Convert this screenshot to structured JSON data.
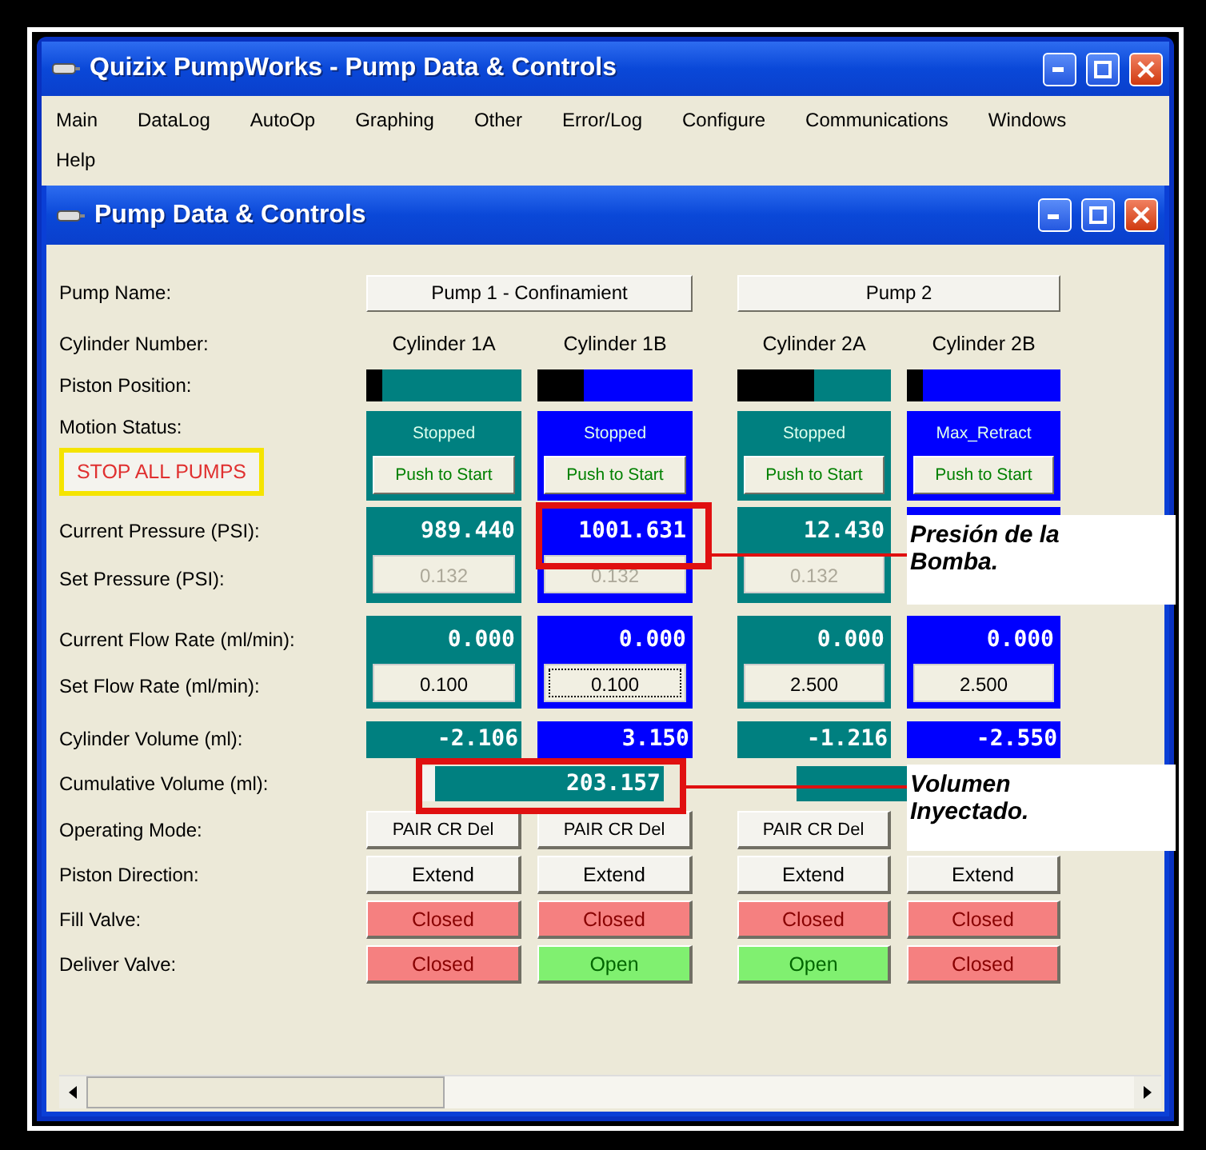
{
  "window": {
    "title": "Quizix PumpWorks - Pump Data & Controls"
  },
  "menu": [
    "Main",
    "DataLog",
    "AutoOp",
    "Graphing",
    "Other",
    "Error/Log",
    "Configure",
    "Communications",
    "Windows",
    "Help"
  ],
  "child_window": {
    "title": "Pump Data & Controls"
  },
  "row_labels": [
    "Pump Name:",
    "Cylinder Number:",
    "Piston Position:",
    "Motion Status:",
    "Current Pressure (PSI):",
    "Set Pressure (PSI):",
    "Current Flow Rate (ml/min):",
    "Set Flow Rate (ml/min):",
    "Cylinder Volume (ml):",
    "Cumulative Volume (ml):",
    "Operating Mode:",
    "Piston Direction:",
    "Fill Valve:",
    "Deliver Valve:"
  ],
  "stop_button": "STOP ALL PUMPS",
  "pumps": [
    {
      "name": "Pump 1 - Confinamient",
      "cumulative": "203.157",
      "cylinders": [
        {
          "number": "Cylinder 1A",
          "color": "#008080",
          "level": 0.1,
          "status": "Stopped",
          "start": "Push to Start",
          "pressure": "989.440",
          "set_pressure": "0.132",
          "flow": "0.000",
          "set_flow": "0.100",
          "focused": false,
          "volume": "-2.106",
          "mode": "PAIR CR Del",
          "direction": "Extend",
          "fill": {
            "label": "Closed",
            "open": false
          },
          "deliver": {
            "label": "Closed",
            "open": false
          }
        },
        {
          "number": "Cylinder 1B",
          "color": "#0000ff",
          "level": 0.3,
          "status": "Stopped",
          "start": "Push to Start",
          "pressure": "1001.631",
          "set_pressure": "0.132",
          "flow": "0.000",
          "set_flow": "0.100",
          "focused": true,
          "volume": "3.150",
          "mode": "PAIR CR Del",
          "direction": "Extend",
          "fill": {
            "label": "Closed",
            "open": false
          },
          "deliver": {
            "label": "Open",
            "open": true
          }
        }
      ]
    },
    {
      "name": "Pump 2",
      "cylinders": [
        {
          "number": "Cylinder 2A",
          "color": "#008080",
          "level": 0.5,
          "status": "Stopped",
          "start": "Push to Start",
          "pressure": "12.430",
          "set_pressure": "0.132",
          "flow": "0.000",
          "set_flow": "2.500",
          "focused": false,
          "volume": "-1.216",
          "mode": "PAIR CR Del",
          "direction": "Extend",
          "fill": {
            "label": "Closed",
            "open": false
          },
          "deliver": {
            "label": "Open",
            "open": true
          }
        },
        {
          "number": "Cylinder 2B",
          "color": "#0000ff",
          "level": 0.1,
          "status": "Max_Retract",
          "start": "Push to Start",
          "flow": "0.000",
          "set_flow": "2.500",
          "focused": false,
          "volume": "-2.550",
          "direction": "Extend",
          "fill": {
            "label": "Closed",
            "open": false
          },
          "deliver": {
            "label": "Closed",
            "open": false
          }
        }
      ]
    }
  ],
  "annotations": [
    {
      "text": "Presión de la Bomba."
    },
    {
      "text": "Volumen Inyectado."
    }
  ]
}
